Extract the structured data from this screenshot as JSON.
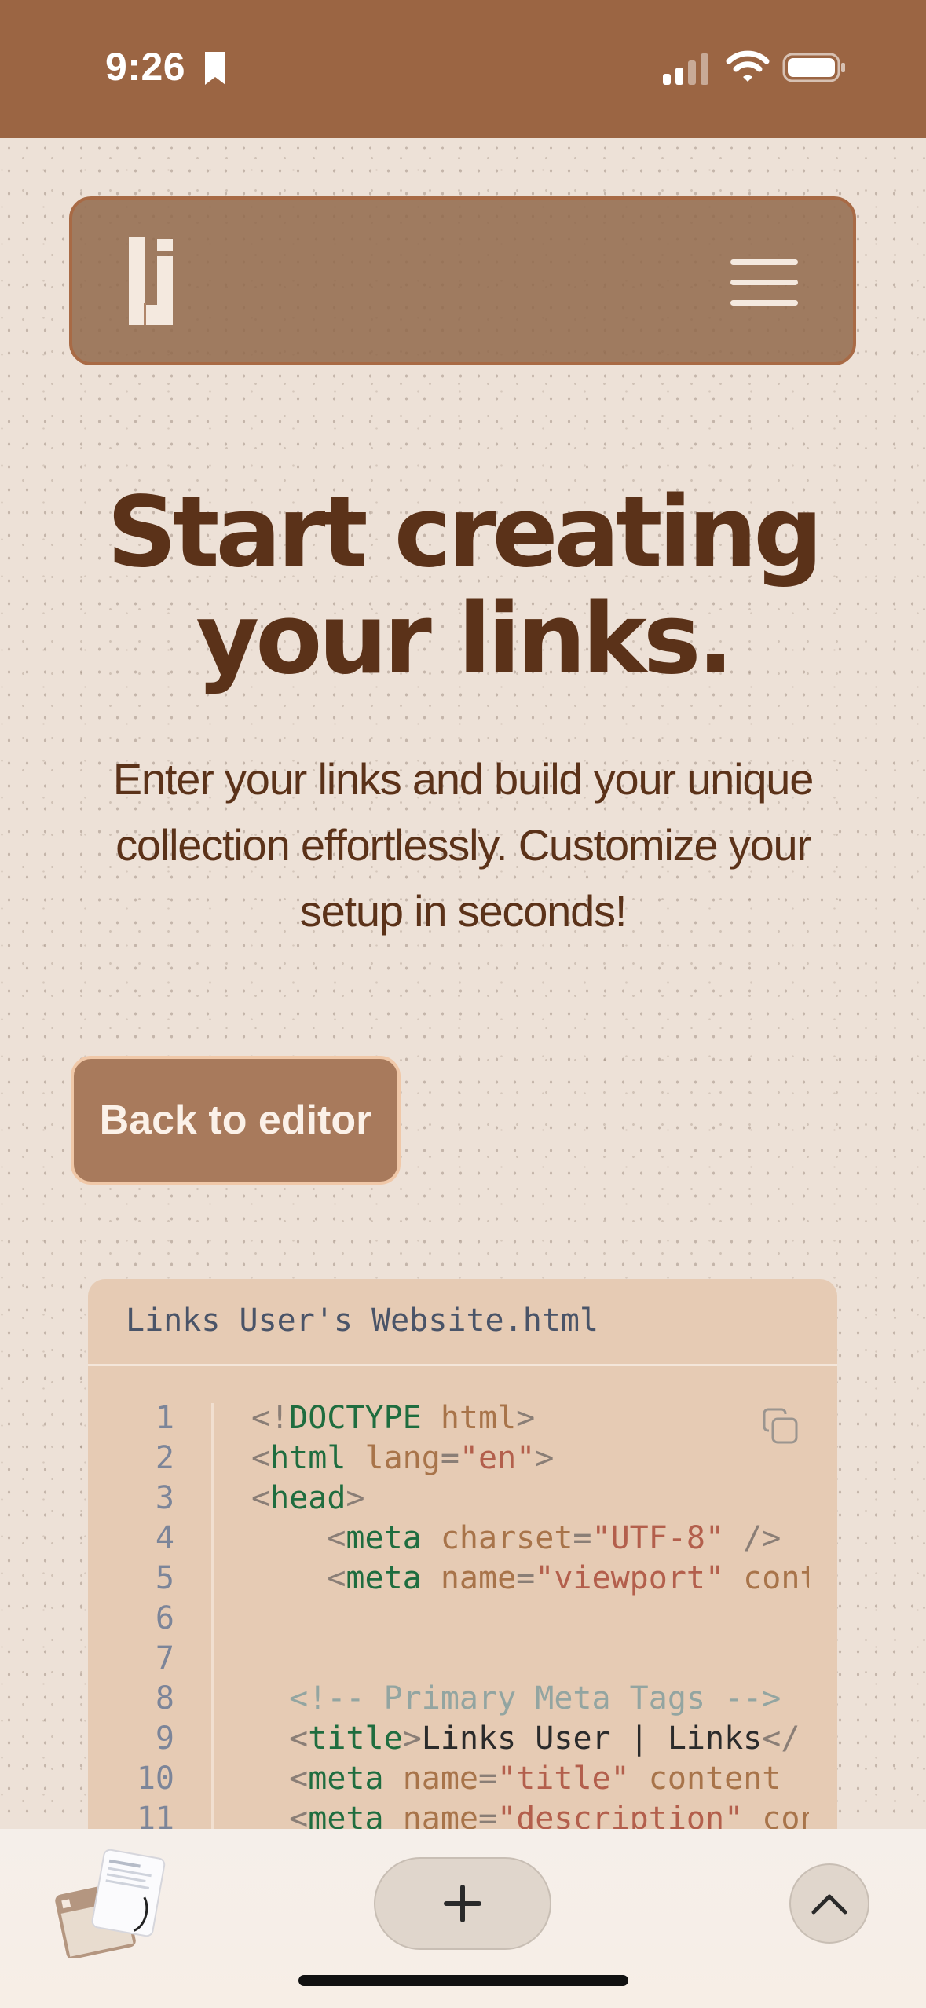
{
  "status_bar": {
    "time": "9:26",
    "icons": [
      "bookmark-icon",
      "signal-icon",
      "wifi-icon",
      "battery-icon"
    ]
  },
  "header": {
    "logo": "li-logo-icon",
    "menu": "hamburger-menu-icon"
  },
  "hero": {
    "title_line1": "Start creating",
    "title_line2": "your links.",
    "subtitle_line1": "Enter your links and build your unique",
    "subtitle_line2": "collection effortlessly. Customize your",
    "subtitle_line3": "setup in seconds!"
  },
  "actions": {
    "back_label": "Back to editor"
  },
  "code": {
    "filename": "Links User's Website.html",
    "copy_icon": "copy-icon",
    "line_numbers": [
      "1",
      "2",
      "3",
      "4",
      "5",
      "6",
      "7",
      "8",
      "9",
      "10",
      "11"
    ],
    "lines": [
      {
        "t": [
          [
            "punc",
            "<!"
          ],
          [
            "tag",
            "DOCTYPE"
          ],
          [
            "txt",
            " "
          ],
          [
            "attr",
            "html"
          ],
          [
            "punc",
            ">"
          ]
        ]
      },
      {
        "t": [
          [
            "punc",
            "<"
          ],
          [
            "tag",
            "html"
          ],
          [
            "txt",
            " "
          ],
          [
            "attr",
            "lang"
          ],
          [
            "punc",
            "="
          ],
          [
            "str",
            "\"en\""
          ],
          [
            "punc",
            ">"
          ]
        ]
      },
      {
        "t": [
          [
            "punc",
            "<"
          ],
          [
            "tag",
            "head"
          ],
          [
            "punc",
            ">"
          ]
        ]
      },
      {
        "t": [
          [
            "txt",
            "    "
          ],
          [
            "punc",
            "<"
          ],
          [
            "tag",
            "meta"
          ],
          [
            "txt",
            " "
          ],
          [
            "attr",
            "charset"
          ],
          [
            "punc",
            "="
          ],
          [
            "str",
            "\"UTF-8\""
          ],
          [
            "txt",
            " "
          ],
          [
            "punc",
            "/>"
          ]
        ]
      },
      {
        "t": [
          [
            "txt",
            "    "
          ],
          [
            "punc",
            "<"
          ],
          [
            "tag",
            "meta"
          ],
          [
            "txt",
            " "
          ],
          [
            "attr",
            "name"
          ],
          [
            "punc",
            "="
          ],
          [
            "str",
            "\"viewport\""
          ],
          [
            "txt",
            " "
          ],
          [
            "attr",
            "content"
          ]
        ]
      },
      {
        "t": []
      },
      {
        "t": []
      },
      {
        "t": [
          [
            "txt",
            "  "
          ],
          [
            "cmt",
            "<!-- Primary Meta Tags -->"
          ]
        ]
      },
      {
        "t": [
          [
            "txt",
            "  "
          ],
          [
            "punc",
            "<"
          ],
          [
            "tag",
            "title"
          ],
          [
            "punc",
            ">"
          ],
          [
            "txt",
            "Links User | Links"
          ],
          [
            "punc",
            "</"
          ]
        ]
      },
      {
        "t": [
          [
            "txt",
            "  "
          ],
          [
            "punc",
            "<"
          ],
          [
            "tag",
            "meta"
          ],
          [
            "txt",
            " "
          ],
          [
            "attr",
            "name"
          ],
          [
            "punc",
            "="
          ],
          [
            "str",
            "\"title\""
          ],
          [
            "txt",
            " "
          ],
          [
            "attr",
            "content"
          ]
        ]
      },
      {
        "t": [
          [
            "txt",
            "  "
          ],
          [
            "punc",
            "<"
          ],
          [
            "tag",
            "meta"
          ],
          [
            "txt",
            " "
          ],
          [
            "attr",
            "name"
          ],
          [
            "punc",
            "="
          ],
          [
            "str",
            "\"description\""
          ],
          [
            "txt",
            " "
          ],
          [
            "attr",
            "content"
          ]
        ]
      }
    ]
  },
  "toolbar": {
    "tabs_icon": "tab-thumbnail",
    "new_tab_icon": "plus-icon",
    "scroll_top_icon": "chevron-up-icon"
  },
  "colors": {
    "brand_brown": "#9b6543",
    "title_brown": "#5b3219",
    "page_bg": "#ede1d7",
    "code_bg": "#e6cbb4"
  }
}
